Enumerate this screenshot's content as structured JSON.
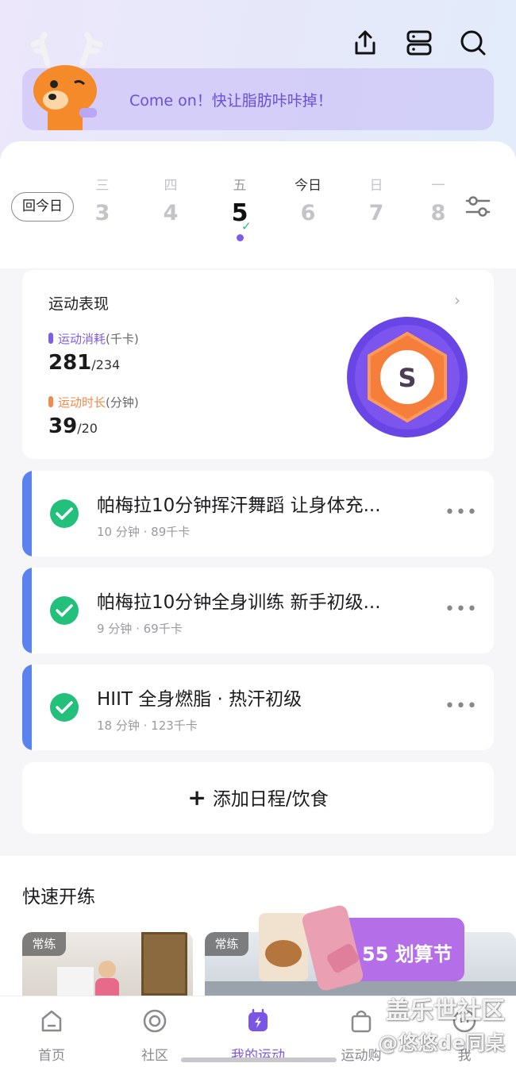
{
  "banner": {
    "text": "Come on！快让脂肪咔咔掉！"
  },
  "calendar": {
    "today_button": "回今日",
    "days": [
      {
        "weekday": "三",
        "date": "3"
      },
      {
        "weekday": "四",
        "date": "4"
      },
      {
        "weekday": "五",
        "date": "5",
        "state": "selected, completed"
      },
      {
        "weekday": "今日",
        "date": "6"
      },
      {
        "weekday": "日",
        "date": "7"
      },
      {
        "weekday": "一",
        "date": "8"
      }
    ]
  },
  "performance": {
    "title": "运动表现",
    "calories": {
      "label": "运动消耗",
      "unit": "(千卡)",
      "value": "281",
      "goal": "/234",
      "color": "#7d5df0"
    },
    "duration": {
      "label": "运动时长",
      "unit": "(分钟)",
      "value": "39",
      "goal": "/20",
      "color": "#f28a4a"
    },
    "badge_letter": "S"
  },
  "tasks": [
    {
      "title": "帕梅拉10分钟挥汗舞蹈 让身体充...",
      "meta": "10 分钟 · 89千卡"
    },
    {
      "title": "帕梅拉10分钟全身训练 新手初级...",
      "meta": "9 分钟 · 69千卡"
    },
    {
      "title": "HIIT 全身燃脂 · 热汗初级",
      "meta": "18 分钟 · 123千卡"
    }
  ],
  "add_schedule": {
    "plus": "+",
    "label": "添加日程/饮食"
  },
  "quick_start": {
    "title": "快速开练",
    "cards": [
      {
        "tag": "常练"
      },
      {
        "tag": "常练"
      }
    ]
  },
  "promo": {
    "text": "55 划算节"
  },
  "tabs": [
    {
      "label": "首页",
      "icon": "home-icon"
    },
    {
      "label": "社区",
      "icon": "community-icon"
    },
    {
      "label": "我的运动",
      "icon": "lightning-calendar-icon",
      "active": true
    },
    {
      "label": "运动购",
      "icon": "shopping-bag-icon"
    },
    {
      "label": "我",
      "icon": "profile-icon"
    }
  ],
  "watermark": {
    "line1": "盖乐世社区",
    "line2": "@悠悠de同桌"
  },
  "colors": {
    "accent": "#7b55e6",
    "stripe": "#5a83f0",
    "check": "#22c07a"
  }
}
